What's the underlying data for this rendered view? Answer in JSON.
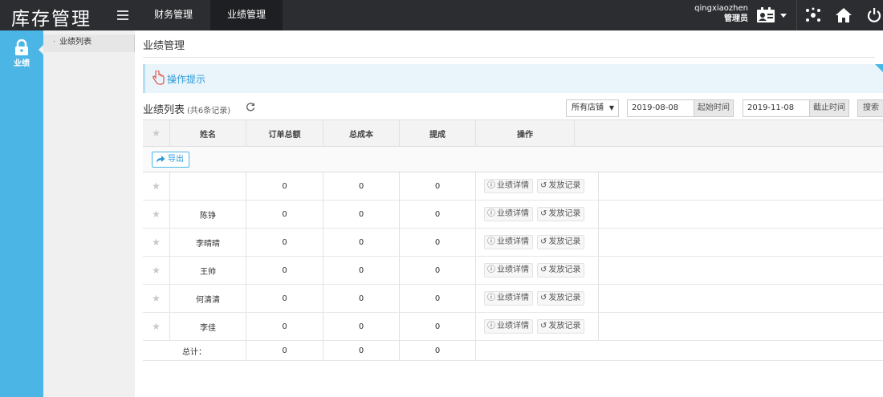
{
  "app": {
    "title": "库存管理"
  },
  "nav": {
    "tabs": [
      {
        "label": "财务管理"
      },
      {
        "label": "业绩管理"
      }
    ]
  },
  "user": {
    "name": "qingxiaozhen",
    "role": "管理员"
  },
  "sidebar": {
    "module_label": "业绩"
  },
  "subnav": {
    "items": [
      {
        "label": "业绩列表"
      }
    ]
  },
  "page": {
    "title": "业绩管理",
    "tip": "操作提示",
    "list_title": "业绩列表",
    "list_count": "(共6条记录)"
  },
  "filters": {
    "store": "所有店铺",
    "start_date": "2019-08-08",
    "start_label": "起始时间",
    "end_date": "2019-11-08",
    "end_label": "截止时间",
    "search_label": "搜索"
  },
  "table": {
    "headers": {
      "name": "姓名",
      "orders": "订单总额",
      "cost": "总成本",
      "commission": "提成",
      "actions": "操作"
    },
    "export_label": "导出",
    "detail_label": "业绩详情",
    "record_label": "发放记录",
    "rows": [
      {
        "name": "",
        "orders": "0",
        "cost": "0",
        "commission": "0"
      },
      {
        "name": "陈铮",
        "orders": "0",
        "cost": "0",
        "commission": "0"
      },
      {
        "name": "李晴晴",
        "orders": "0",
        "cost": "0",
        "commission": "0"
      },
      {
        "name": "王帅",
        "orders": "0",
        "cost": "0",
        "commission": "0"
      },
      {
        "name": "何清清",
        "orders": "0",
        "cost": "0",
        "commission": "0"
      },
      {
        "name": "李佳",
        "orders": "0",
        "cost": "0",
        "commission": "0"
      }
    ],
    "total": {
      "label": "总计：",
      "orders": "0",
      "cost": "0",
      "commission": "0"
    }
  },
  "colors": {
    "topbar": "#2b2d30",
    "sidebar": "#4bb6e6",
    "accent": "#2d9ad6"
  }
}
